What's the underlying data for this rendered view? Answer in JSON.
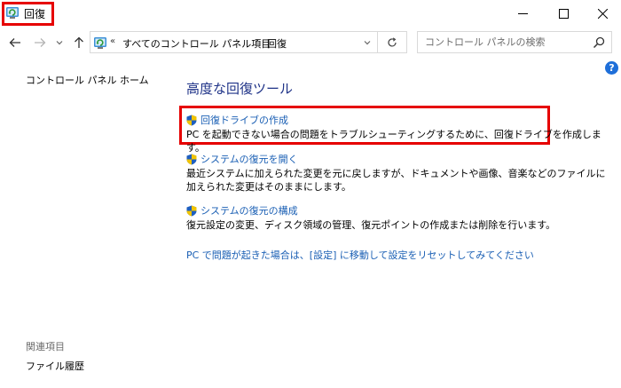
{
  "window": {
    "title": "回復",
    "controls": {
      "minimize": "minimize",
      "maximize": "maximize",
      "close": "close"
    }
  },
  "nav": {
    "breadcrumb_prefix": "«",
    "breadcrumbs": [
      "すべてのコントロール パネル項目",
      "回復"
    ],
    "breadcrumb_separator": "›",
    "search_placeholder": "コントロール パネルの検索"
  },
  "sidebar": {
    "home_link": "コントロール パネル ホーム",
    "related_title": "関連項目",
    "related_items": [
      "ファイル履歴"
    ]
  },
  "main": {
    "title": "高度な回復ツール",
    "tasks": [
      {
        "link": "回復ドライブの作成",
        "description": "PC を起動できない場合の問題をトラブルシューティングするために、回復ドライブを作成します。",
        "highlighted": true
      },
      {
        "link": "システムの復元を開く",
        "description": "最近システムに加えられた変更を元に戻しますが、ドキュメントや画像、音楽などのファイルに加えられた変更はそのままにします。",
        "highlighted": false
      },
      {
        "link": "システムの復元の構成",
        "description": "復元設定の変更、ディスク領域の管理、復元ポイントの作成または削除を行います。",
        "highlighted": false
      }
    ],
    "reset_link": "PC で問題が起きた場合は、[設定] に移動して設定をリセットしてみてください"
  },
  "colors": {
    "highlight": "#e60000",
    "link": "#1a5fb4",
    "title": "#1e3287",
    "help": "#1e6fd9"
  },
  "icons": {
    "app": "recovery-icon",
    "shield": "uac-shield-icon",
    "help": "help-icon",
    "search": "search-icon",
    "refresh": "refresh-icon"
  },
  "help_glyph": "?"
}
